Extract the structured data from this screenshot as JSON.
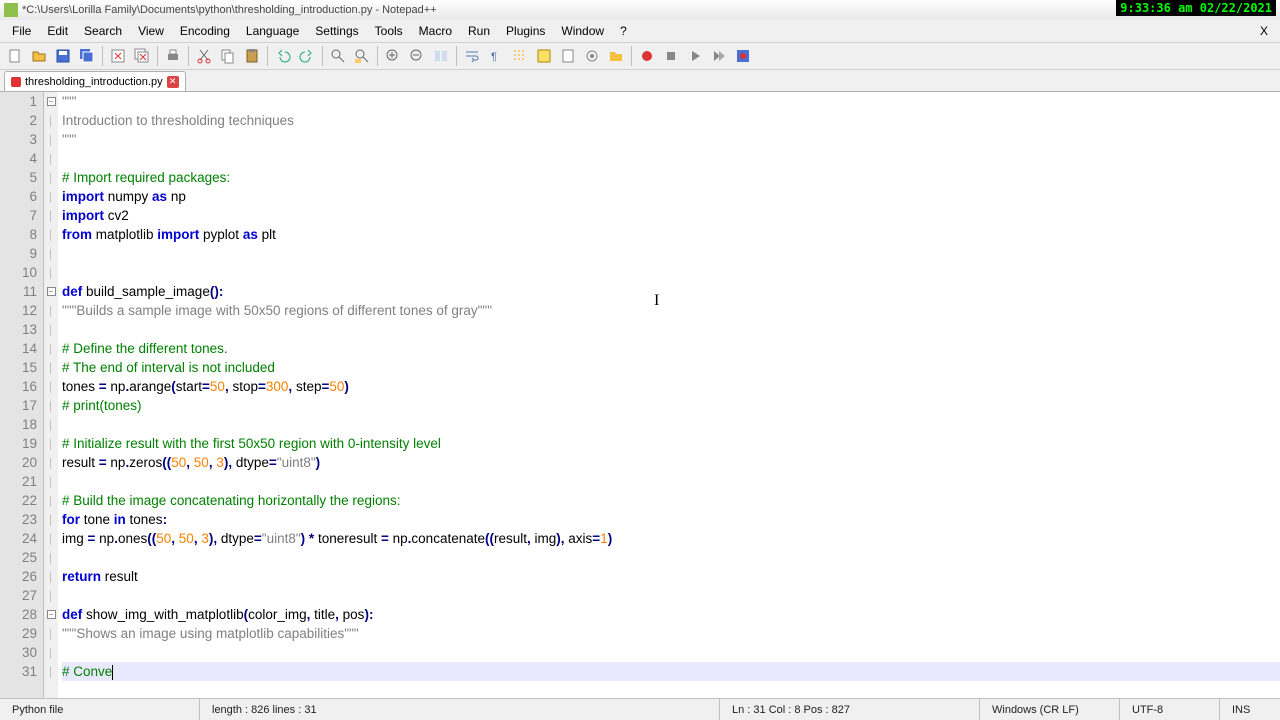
{
  "title": "*C:\\Users\\Lorilla Family\\Documents\\python\\thresholding_introduction.py - Notepad++",
  "timestamp": "9:33:36 am 02/22/2021",
  "menu": [
    "File",
    "Edit",
    "Search",
    "View",
    "Encoding",
    "Language",
    "Settings",
    "Tools",
    "Macro",
    "Run",
    "Plugins",
    "Window",
    "?"
  ],
  "tab": {
    "label": "thresholding_introduction.py"
  },
  "lines": [
    {
      "n": 1,
      "fold": "box",
      "html": "<span class='str'>\"\"\"</span>"
    },
    {
      "n": 2,
      "html": "<span class='str'>Introduction to thresholding techniques</span>"
    },
    {
      "n": 3,
      "html": "<span class='str'>\"\"\"</span>"
    },
    {
      "n": 4,
      "html": ""
    },
    {
      "n": 5,
      "html": "<span class='com'># Import required packages:</span>"
    },
    {
      "n": 6,
      "html": "<span class='kw'>import</span> numpy <span class='kw'>as</span> np"
    },
    {
      "n": 7,
      "html": "<span class='kw'>import</span> cv2"
    },
    {
      "n": 8,
      "html": "<span class='kw'>from</span> matplotlib <span class='kw'>import</span> pyplot <span class='kw'>as</span> plt"
    },
    {
      "n": 9,
      "html": ""
    },
    {
      "n": 10,
      "html": ""
    },
    {
      "n": 11,
      "fold": "box",
      "html": "<span class='kw'>def</span> build_sample_image<span class='op'>()</span><span class='op'>:</span>"
    },
    {
      "n": 12,
      "html": "<span class='str'>\"\"\"Builds a sample image with 50x50 regions of different tones of gray\"\"\"</span>"
    },
    {
      "n": 13,
      "html": ""
    },
    {
      "n": 14,
      "html": "<span class='com'># Define the different tones.</span>"
    },
    {
      "n": 15,
      "html": "<span class='com'># The end of interval is not included</span>"
    },
    {
      "n": 16,
      "html": "tones <span class='op'>=</span> np<span class='op'>.</span>arange<span class='op'>(</span>start<span class='op'>=</span><span class='num'>50</span><span class='op'>,</span> stop<span class='op'>=</span><span class='num'>300</span><span class='op'>,</span> step<span class='op'>=</span><span class='num'>50</span><span class='op'>)</span>"
    },
    {
      "n": 17,
      "html": "<span class='com'># print(tones)</span>"
    },
    {
      "n": 18,
      "html": ""
    },
    {
      "n": 19,
      "html": "<span class='com'># Initialize result with the first 50x50 region with 0-intensity level</span>"
    },
    {
      "n": 20,
      "html": "result <span class='op'>=</span> np<span class='op'>.</span>zeros<span class='op'>((</span><span class='num'>50</span><span class='op'>,</span> <span class='num'>50</span><span class='op'>,</span> <span class='num'>3</span><span class='op'>),</span> dtype<span class='op'>=</span><span class='str'>\"uint8\"</span><span class='op'>)</span>"
    },
    {
      "n": 21,
      "html": ""
    },
    {
      "n": 22,
      "html": "<span class='com'># Build the image concatenating horizontally the regions:</span>"
    },
    {
      "n": 23,
      "html": "<span class='kw'>for</span> tone <span class='kw'>in</span> tones<span class='op'>:</span>"
    },
    {
      "n": 24,
      "html": "img <span class='op'>=</span> np<span class='op'>.</span>ones<span class='op'>((</span><span class='num'>50</span><span class='op'>,</span> <span class='num'>50</span><span class='op'>,</span> <span class='num'>3</span><span class='op'>),</span> dtype<span class='op'>=</span><span class='str'>\"uint8\"</span><span class='op'>)</span> <span class='op'>*</span> toneresult <span class='op'>=</span> np<span class='op'>.</span>concatenate<span class='op'>((</span>result<span class='op'>,</span> img<span class='op'>),</span> axis<span class='op'>=</span><span class='num'>1</span><span class='op'>)</span>"
    },
    {
      "n": 25,
      "html": ""
    },
    {
      "n": 26,
      "html": "<span class='kw'>return</span> result"
    },
    {
      "n": 27,
      "html": ""
    },
    {
      "n": 28,
      "fold": "box",
      "html": "<span class='kw'>def</span> show_img_with_matplotlib<span class='op'>(</span>color_img<span class='op'>,</span> title<span class='op'>,</span> pos<span class='op'>)</span><span class='op'>:</span>"
    },
    {
      "n": 29,
      "html": "<span class='str'>\"\"\"Shows an image using matplotlib capabilities\"\"\"</span>"
    },
    {
      "n": 30,
      "html": ""
    },
    {
      "n": 31,
      "caret": true,
      "html": "<span class='com'># Conve</span><span class='cursor'></span>"
    }
  ],
  "status": {
    "filetype": "Python file",
    "length": "length : 826    lines : 31",
    "pos": "Ln : 31    Col : 8    Pos : 827",
    "eol": "Windows (CR LF)",
    "enc": "UTF-8",
    "ins": "INS"
  }
}
